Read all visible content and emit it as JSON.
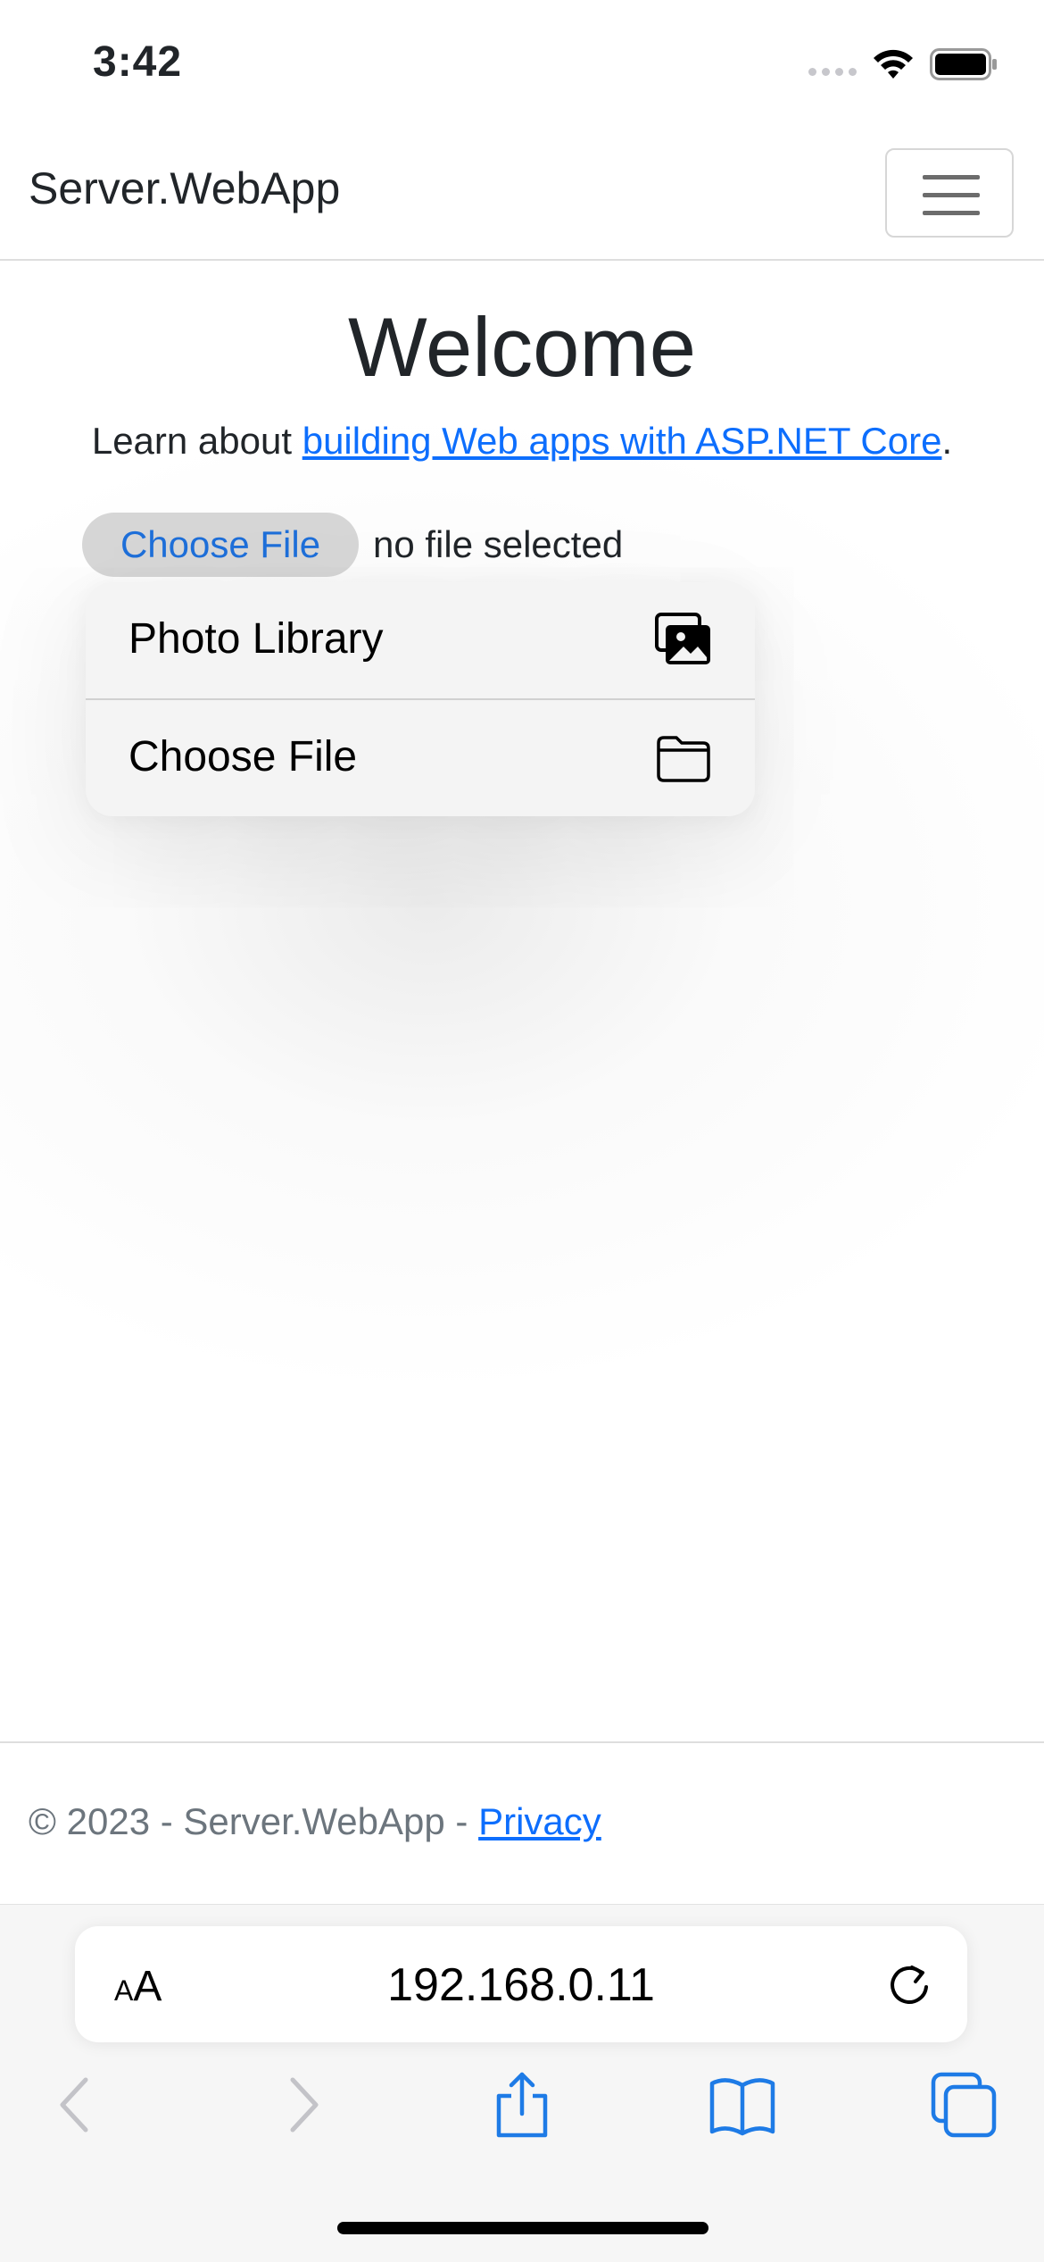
{
  "status_bar": {
    "time": "3:42"
  },
  "navbar": {
    "brand": "Server.WebApp"
  },
  "main": {
    "heading": "Welcome",
    "learn_prefix": "Learn about ",
    "learn_link": "building Web apps with ASP.NET Core",
    "learn_suffix": ".",
    "file_button": "Choose File",
    "file_status": "no file selected"
  },
  "popup_menu": {
    "items": [
      {
        "label": "Photo Library",
        "icon": "photo-library-icon"
      },
      {
        "label": "Choose File",
        "icon": "folder-icon"
      }
    ]
  },
  "footer": {
    "text": "© 2023 - Server.WebApp - ",
    "privacy_link": "Privacy"
  },
  "browser": {
    "text_size_label_small": "A",
    "text_size_label_large": "A",
    "url": "192.168.0.11"
  },
  "colors": {
    "link": "#0d6efd",
    "safari_blue": "#1e7be6",
    "disabled_gray": "#c3c3c8"
  }
}
